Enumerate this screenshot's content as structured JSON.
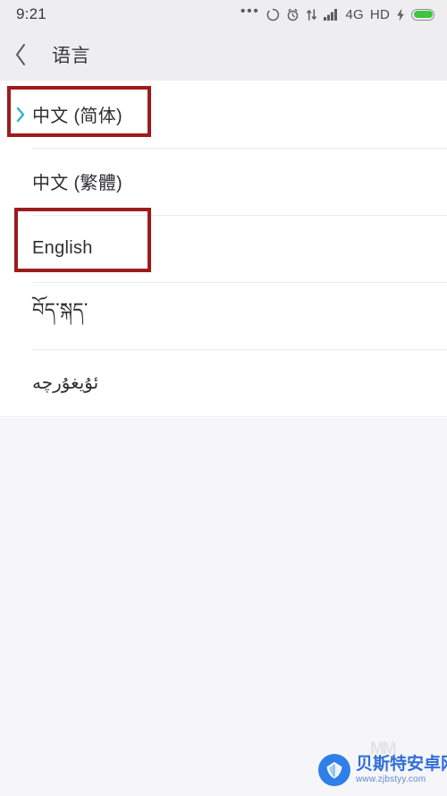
{
  "status_bar": {
    "time": "9:21",
    "more_dots": "•••",
    "icons": [
      "more-dots-icon",
      "sync-circle-icon",
      "alarm-clock-icon",
      "data-transfer-icon",
      "signal-bars-icon"
    ],
    "network_type": "4G",
    "voice_hd": "HD",
    "charging_icon": "lightning-bolt-icon",
    "battery_icon": "battery-icon",
    "battery_color": "#3ec63e",
    "background_color": "#eeedf0"
  },
  "header": {
    "back_icon": "back-chevron-icon",
    "title": "语言",
    "background_color": "#eeedf0"
  },
  "language_list": {
    "items": [
      {
        "label": "中文 (简体)",
        "selected": true,
        "indicator_icon": "chevron-right-icon",
        "indicator_color": "#2eb6c8"
      },
      {
        "label": "中文 (繁體)",
        "selected": false
      },
      {
        "label": "English",
        "selected": false
      },
      {
        "label": "བོད་སྐད་",
        "selected": false
      },
      {
        "label": "ئۇيغۇرچە",
        "selected": false
      }
    ]
  },
  "annotations": {
    "color": "#9e1b1b",
    "boxes": [
      {
        "target": "中文 (简体)"
      },
      {
        "target": "English"
      }
    ]
  },
  "watermark": {
    "site_name": "贝斯特安卓网",
    "url": "www.zjbstyy.com",
    "logo_icon": "shell-logo-icon",
    "brand_color": "#2f6fd8"
  },
  "misc": {
    "faint_glyph": "MM"
  }
}
